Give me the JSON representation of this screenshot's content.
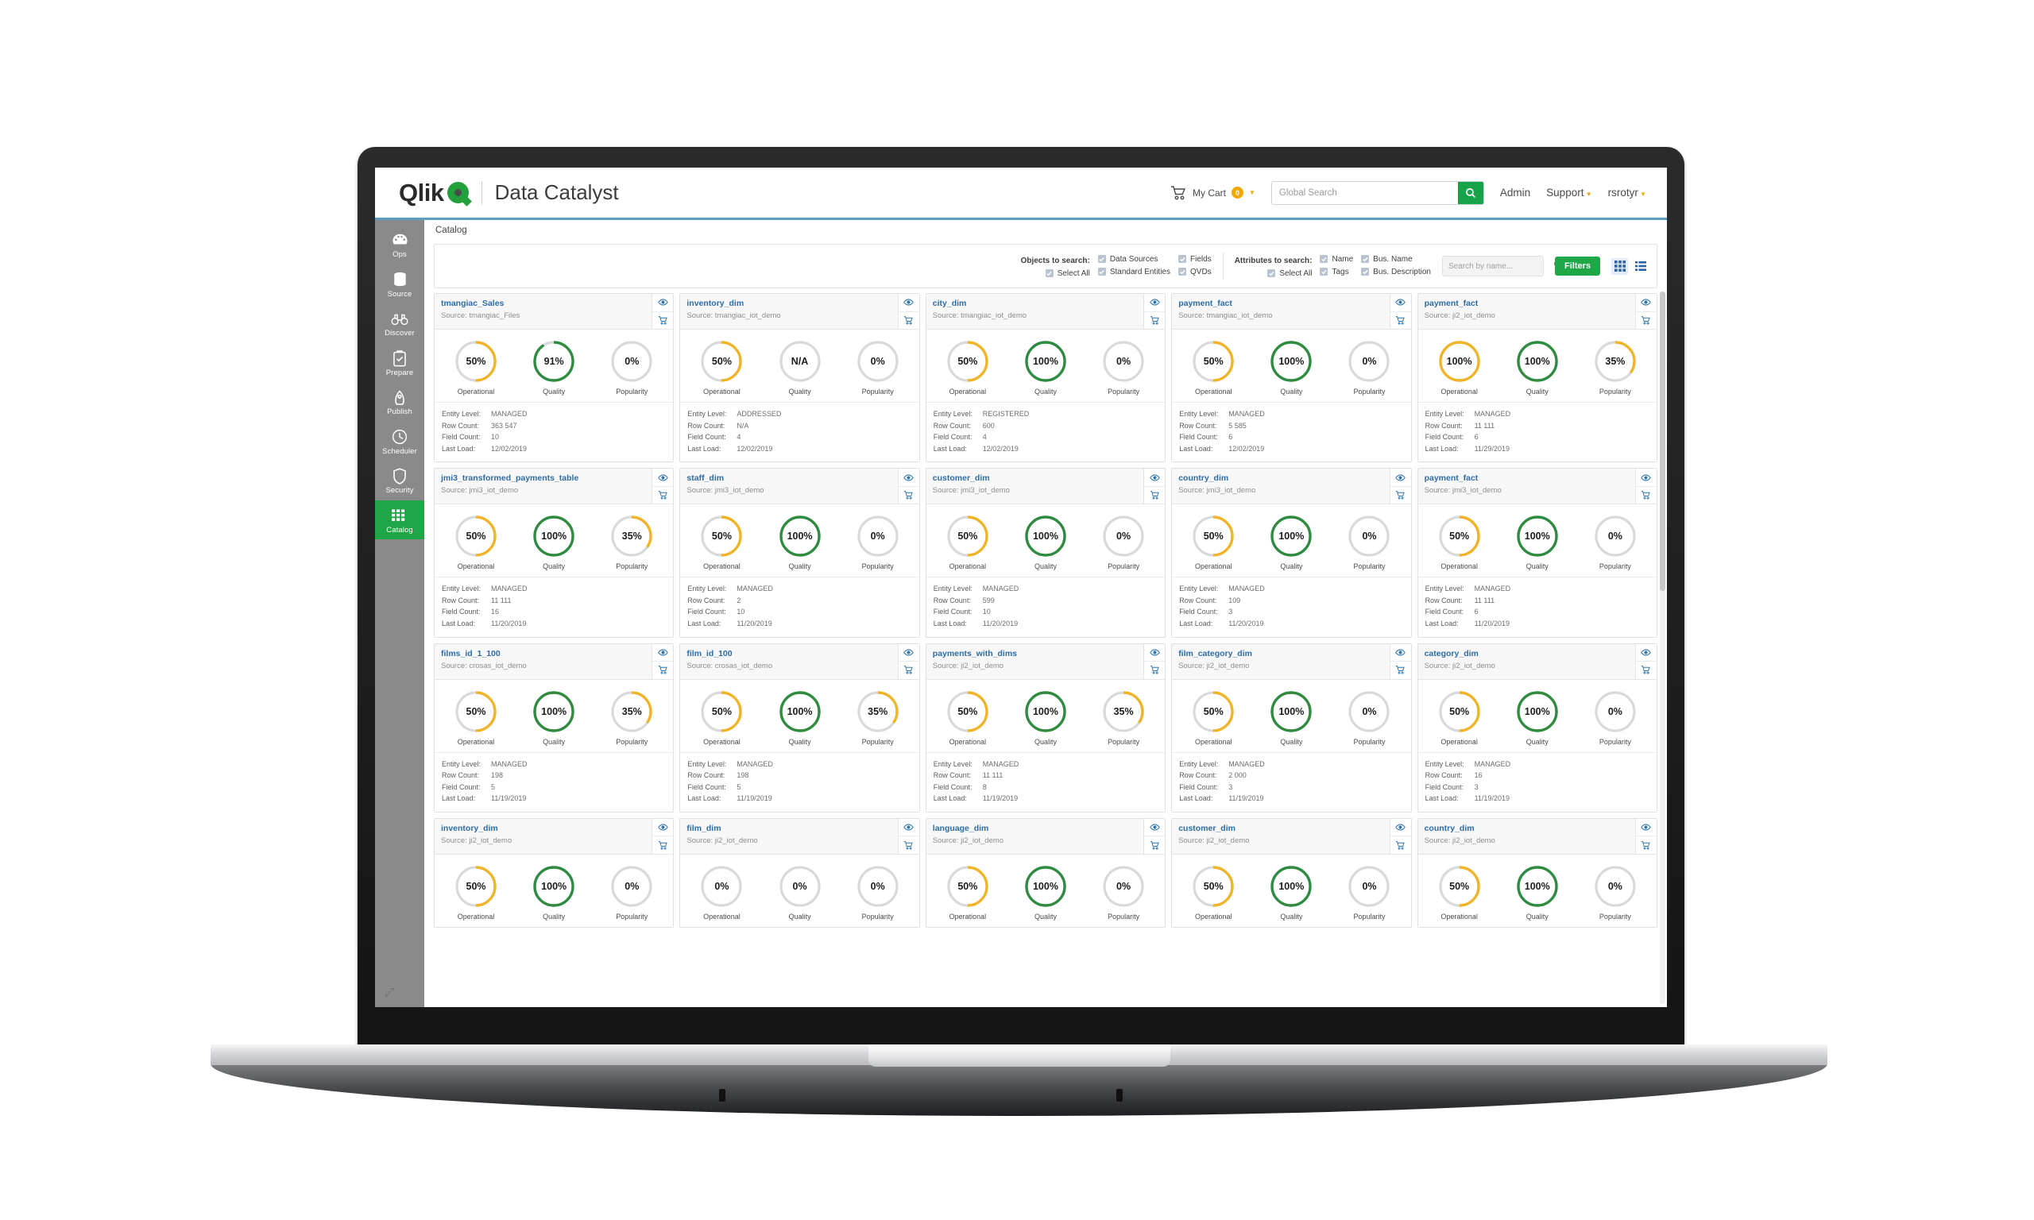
{
  "header": {
    "brand_name": "Qlik",
    "app_title": "Data Catalyst",
    "cart_label": "My Cart",
    "cart_count": "0",
    "search_placeholder": "Global Search",
    "search_value": "",
    "nav": [
      {
        "label": "Admin",
        "has_caret": false
      },
      {
        "label": "Support",
        "has_caret": true
      },
      {
        "label": "rsrotyr",
        "has_caret": true
      }
    ]
  },
  "sidebar": {
    "items": [
      {
        "label": "Ops",
        "icon": "gauge-icon",
        "active": false
      },
      {
        "label": "Source",
        "icon": "database-icon",
        "active": false
      },
      {
        "label": "Discover",
        "icon": "binoculars-icon",
        "active": false
      },
      {
        "label": "Prepare",
        "icon": "clipboard-check-icon",
        "active": false
      },
      {
        "label": "Publish",
        "icon": "publish-icon",
        "active": false
      },
      {
        "label": "Scheduler",
        "icon": "clock-icon",
        "active": false
      },
      {
        "label": "Security",
        "icon": "shield-icon",
        "active": false
      },
      {
        "label": "Catalog",
        "icon": "grid-icon",
        "active": true
      }
    ]
  },
  "breadcrumb": "Catalog",
  "filters": {
    "objects_title": "Objects to search:",
    "objects": [
      {
        "label": "Select All",
        "checked": true
      },
      {
        "label": "Data Sources",
        "checked": true
      },
      {
        "label": "Standard Entities",
        "checked": true
      },
      {
        "label": "Fields",
        "checked": true
      },
      {
        "label": "QVDs",
        "checked": true
      }
    ],
    "attributes_title": "Attributes to search:",
    "attributes": [
      {
        "label": "Select All",
        "checked": true
      },
      {
        "label": "Name",
        "checked": true
      },
      {
        "label": "Tags",
        "checked": true
      },
      {
        "label": "Bus. Name",
        "checked": true
      },
      {
        "label": "Bus. Description",
        "checked": true
      }
    ],
    "name_search_placeholder": "Search by name...",
    "name_search_value": "",
    "filters_button": "Filters",
    "view_grid_selected": true
  },
  "card_labels": {
    "source_prefix": "Source:",
    "gauge_operational": "Operational",
    "gauge_quality": "Quality",
    "gauge_popularity": "Popularity",
    "meta_entity_level": "Entity Level:",
    "meta_row_count": "Row Count:",
    "meta_field_count": "Field Count:",
    "meta_last_load": "Last Load:"
  },
  "colors": {
    "brand_green": "#1fa747",
    "gauge_green": "#2e8b40",
    "gauge_amber": "#f0b429",
    "gauge_track": "#d8d9db",
    "link_blue": "#2e6ca4",
    "accent_blue": "#5a9ec4"
  },
  "cards": [
    {
      "title": "tmangiac_Sales",
      "source": "tmangiac_Files",
      "operational": "50%",
      "quality": "91%",
      "popularity": "0%",
      "op_pct": 50,
      "q_pct": 91,
      "pop_pct": 0,
      "entity_level": "MANAGED",
      "row_count": "363 547",
      "field_count": "10",
      "last_load": "12/02/2019"
    },
    {
      "title": "inventory_dim",
      "source": "tmangiac_iot_demo",
      "operational": "50%",
      "quality": "N/A",
      "popularity": "0%",
      "op_pct": 50,
      "q_pct": 0,
      "pop_pct": 0,
      "entity_level": "ADDRESSED",
      "row_count": "N/A",
      "field_count": "4",
      "last_load": "12/02/2019"
    },
    {
      "title": "city_dim",
      "source": "tmangiac_iot_demo",
      "operational": "50%",
      "quality": "100%",
      "popularity": "0%",
      "op_pct": 50,
      "q_pct": 100,
      "pop_pct": 0,
      "entity_level": "REGISTERED",
      "row_count": "600",
      "field_count": "4",
      "last_load": "12/02/2019"
    },
    {
      "title": "payment_fact",
      "source": "tmangiac_iot_demo",
      "operational": "50%",
      "quality": "100%",
      "popularity": "0%",
      "op_pct": 50,
      "q_pct": 100,
      "pop_pct": 0,
      "entity_level": "MANAGED",
      "row_count": "5 585",
      "field_count": "6",
      "last_load": "12/02/2019"
    },
    {
      "title": "payment_fact",
      "source": "ji2_iot_demo",
      "operational": "100%",
      "quality": "100%",
      "popularity": "35%",
      "op_pct": 100,
      "q_pct": 100,
      "pop_pct": 35,
      "entity_level": "MANAGED",
      "row_count": "11 111",
      "field_count": "6",
      "last_load": "11/29/2019"
    },
    {
      "title": "jmi3_transformed_payments_table",
      "source": "jmi3_iot_demo",
      "operational": "50%",
      "quality": "100%",
      "popularity": "35%",
      "op_pct": 50,
      "q_pct": 100,
      "pop_pct": 35,
      "entity_level": "MANAGED",
      "row_count": "11 111",
      "field_count": "16",
      "last_load": "11/20/2019"
    },
    {
      "title": "staff_dim",
      "source": "jmi3_iot_demo",
      "operational": "50%",
      "quality": "100%",
      "popularity": "0%",
      "op_pct": 50,
      "q_pct": 100,
      "pop_pct": 0,
      "entity_level": "MANAGED",
      "row_count": "2",
      "field_count": "10",
      "last_load": "11/20/2019"
    },
    {
      "title": "customer_dim",
      "source": "jmi3_iot_demo",
      "operational": "50%",
      "quality": "100%",
      "popularity": "0%",
      "op_pct": 50,
      "q_pct": 100,
      "pop_pct": 0,
      "entity_level": "MANAGED",
      "row_count": "599",
      "field_count": "10",
      "last_load": "11/20/2019"
    },
    {
      "title": "country_dim",
      "source": "jmi3_iot_demo",
      "operational": "50%",
      "quality": "100%",
      "popularity": "0%",
      "op_pct": 50,
      "q_pct": 100,
      "pop_pct": 0,
      "entity_level": "MANAGED",
      "row_count": "109",
      "field_count": "3",
      "last_load": "11/20/2019"
    },
    {
      "title": "payment_fact",
      "source": "jmi3_iot_demo",
      "operational": "50%",
      "quality": "100%",
      "popularity": "0%",
      "op_pct": 50,
      "q_pct": 100,
      "pop_pct": 0,
      "entity_level": "MANAGED",
      "row_count": "11 111",
      "field_count": "6",
      "last_load": "11/20/2019"
    },
    {
      "title": "films_id_1_100",
      "source": "crosas_iot_demo",
      "operational": "50%",
      "quality": "100%",
      "popularity": "35%",
      "op_pct": 50,
      "q_pct": 100,
      "pop_pct": 35,
      "entity_level": "MANAGED",
      "row_count": "198",
      "field_count": "5",
      "last_load": "11/19/2019"
    },
    {
      "title": "film_id_100",
      "source": "crosas_iot_demo",
      "operational": "50%",
      "quality": "100%",
      "popularity": "35%",
      "op_pct": 50,
      "q_pct": 100,
      "pop_pct": 35,
      "entity_level": "MANAGED",
      "row_count": "198",
      "field_count": "5",
      "last_load": "11/19/2019"
    },
    {
      "title": "payments_with_dims",
      "source": "ji2_iot_demo",
      "operational": "50%",
      "quality": "100%",
      "popularity": "35%",
      "op_pct": 50,
      "q_pct": 100,
      "pop_pct": 35,
      "entity_level": "MANAGED",
      "row_count": "11 111",
      "field_count": "8",
      "last_load": "11/19/2019"
    },
    {
      "title": "film_category_dim",
      "source": "ji2_iot_demo",
      "operational": "50%",
      "quality": "100%",
      "popularity": "0%",
      "op_pct": 50,
      "q_pct": 100,
      "pop_pct": 0,
      "entity_level": "MANAGED",
      "row_count": "2 000",
      "field_count": "3",
      "last_load": "11/19/2019"
    },
    {
      "title": "category_dim",
      "source": "ji2_iot_demo",
      "operational": "50%",
      "quality": "100%",
      "popularity": "0%",
      "op_pct": 50,
      "q_pct": 100,
      "pop_pct": 0,
      "entity_level": "MANAGED",
      "row_count": "16",
      "field_count": "3",
      "last_load": "11/19/2019"
    },
    {
      "title": "inventory_dim",
      "source": "ji2_iot_demo",
      "operational": "50%",
      "quality": "100%",
      "popularity": "0%",
      "op_pct": 50,
      "q_pct": 100,
      "pop_pct": 0,
      "entity_level": "",
      "row_count": "",
      "field_count": "",
      "last_load": ""
    },
    {
      "title": "film_dim",
      "source": "ji2_iot_demo",
      "operational": "0%",
      "quality": "0%",
      "popularity": "0%",
      "op_pct": 0,
      "q_pct": 0,
      "pop_pct": 0,
      "entity_level": "",
      "row_count": "",
      "field_count": "",
      "last_load": ""
    },
    {
      "title": "language_dim",
      "source": "ji2_iot_demo",
      "operational": "50%",
      "quality": "100%",
      "popularity": "0%",
      "op_pct": 50,
      "q_pct": 100,
      "pop_pct": 0,
      "entity_level": "",
      "row_count": "",
      "field_count": "",
      "last_load": ""
    },
    {
      "title": "customer_dim",
      "source": "ji2_iot_demo",
      "operational": "50%",
      "quality": "100%",
      "popularity": "0%",
      "op_pct": 50,
      "q_pct": 100,
      "pop_pct": 0,
      "entity_level": "",
      "row_count": "",
      "field_count": "",
      "last_load": ""
    },
    {
      "title": "country_dim",
      "source": "ji2_iot_demo",
      "operational": "50%",
      "quality": "100%",
      "popularity": "0%",
      "op_pct": 50,
      "q_pct": 100,
      "pop_pct": 0,
      "entity_level": "",
      "row_count": "",
      "field_count": "",
      "last_load": ""
    }
  ]
}
